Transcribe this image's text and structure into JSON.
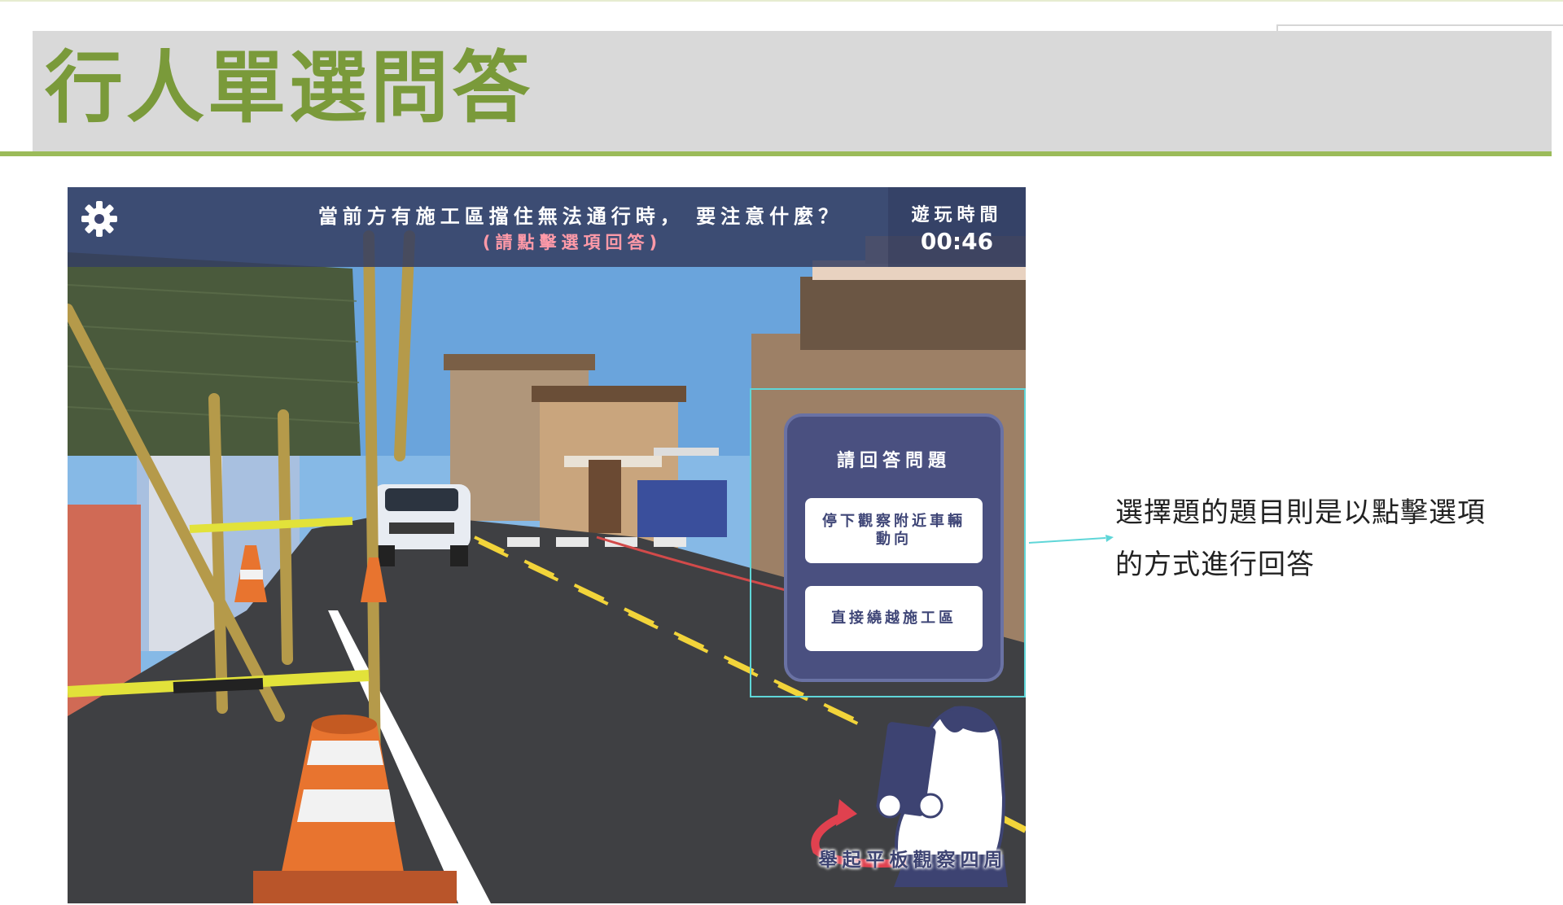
{
  "slide": {
    "title": "行人單選問答",
    "callout": "選擇題的題目則是以點擊選項的方式進行回答"
  },
  "game": {
    "settings_icon": "gear-icon",
    "question": "當前方有施工區擋住無法通行時， 要注意什麼？",
    "hint": "(請點擊選項回答)",
    "timer_label": "遊玩時間",
    "timer_value": "00:46",
    "answer_panel": {
      "title": "請回答問題",
      "options": [
        "停下觀察附近車輛動向",
        "直接繞越施工區"
      ]
    },
    "instruction": "舉起平板觀察四周"
  },
  "colors": {
    "title_green": "#7a9a3a",
    "band_gray": "#d9d9d9",
    "underline_green": "#9bbb59",
    "hud_navy": "#343e62",
    "hint_pink": "#ff9aa8",
    "highlight_cyan": "#5fd6d8"
  }
}
